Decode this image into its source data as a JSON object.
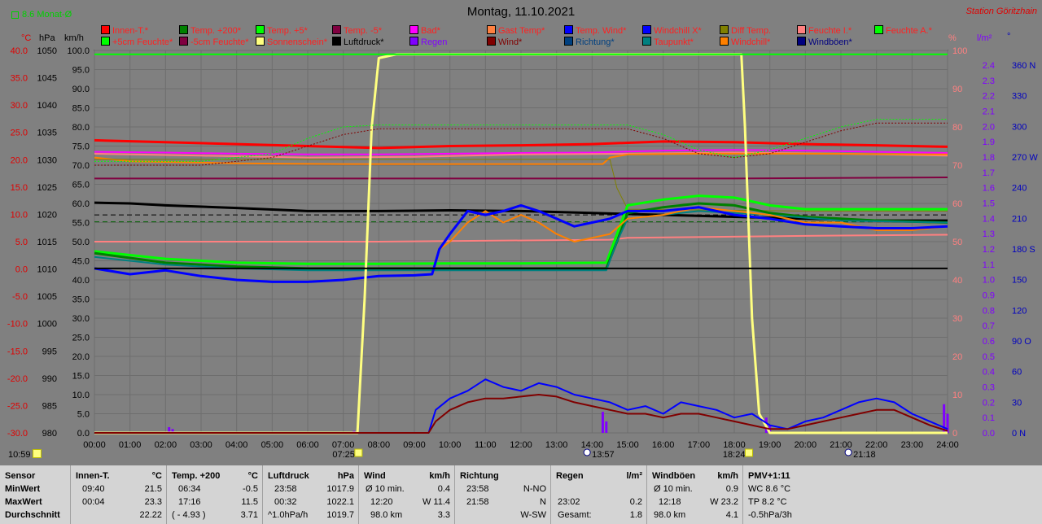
{
  "title": "Montag, 11.10.2021",
  "station": "Station Göritzhain",
  "monat": "8.6 Monat-Ø",
  "axis_headers": {
    "temp": "°C",
    "hpa": "hPa",
    "kmh": "km/h",
    "pct": "%",
    "lqm": "l/m²",
    "deg": "°"
  },
  "legend": [
    {
      "label": "Innen-T.*",
      "color": "#ff0000",
      "text_color": "#ff2020"
    },
    {
      "label": "Temp. +200*",
      "color": "#008000",
      "text_color": "#ff2020"
    },
    {
      "label": "Temp. +5*",
      "color": "#00ff00",
      "text_color": "#ff2020"
    },
    {
      "label": "Temp. -5*",
      "color": "#800040",
      "text_color": "#ff2020"
    },
    {
      "label": "Bad*",
      "color": "#ff00ff",
      "text_color": "#ff2020"
    },
    {
      "label": "Gast Temp*",
      "color": "#ff8040",
      "text_color": "#ff2020"
    },
    {
      "label": "Temp. Wind*",
      "color": "#0000ff",
      "text_color": "#ff2020"
    },
    {
      "label": "Windchill X*",
      "color": "#0000ff",
      "text_color": "#ff2020"
    },
    {
      "label": "Diff Temp.",
      "color": "#808000",
      "text_color": "#ff2020"
    },
    {
      "label": "Feuchte I.*",
      "color": "#ff8080",
      "text_color": "#ff2020"
    },
    {
      "label": "Feuchte A.*",
      "color": "#00ff00",
      "text_color": "#ff2020"
    },
    {
      "label": "+5cm Feuchte*",
      "color": "#00ff00",
      "text_color": "#ff2020"
    },
    {
      "label": "-5cm Feuchte*",
      "color": "#800040",
      "text_color": "#ff2020"
    },
    {
      "label": "Sonnenschein*",
      "color": "#ffff80",
      "text_color": "#ff2020"
    },
    {
      "label": "Luftdruck*",
      "color": "#000000",
      "text_color": "#000000"
    },
    {
      "label": "Regen",
      "color": "#8000ff",
      "text_color": "#8000ff"
    },
    {
      "label": "Wind*",
      "color": "#800000",
      "text_color": "#800000"
    },
    {
      "label": "Richtung*",
      "color": "#004080",
      "text_color": "#004080"
    },
    {
      "label": "Taupunkt*",
      "color": "#008080",
      "text_color": "#ff2020"
    },
    {
      "label": "Windchill*",
      "color": "#ff8000",
      "text_color": "#ff2020"
    },
    {
      "label": "Windböen*",
      "color": "#000080",
      "text_color": "#000080"
    }
  ],
  "chart_data": {
    "type": "line",
    "title": "Montag, 11.10.2021",
    "x_ticks": [
      "00:00",
      "01:00",
      "02:00",
      "03:00",
      "04:00",
      "05:00",
      "06:00",
      "07:00",
      "08:00",
      "09:00",
      "10:00",
      "11:00",
      "12:00",
      "13:00",
      "14:00",
      "15:00",
      "16:00",
      "17:00",
      "18:00",
      "19:00",
      "20:00",
      "21:00",
      "22:00",
      "23:00",
      "24:00"
    ],
    "y_axes": {
      "temp_c": [
        "40.0",
        "35.0",
        "30.0",
        "25.0",
        "20.0",
        "15.0",
        "10.0",
        "5.0",
        "0.0",
        "-5.0",
        "-10.0",
        "-15.0",
        "-20.0",
        "-25.0",
        "-30.0"
      ],
      "hpa": [
        "1050",
        "1045",
        "1040",
        "1035",
        "1030",
        "1025",
        "1020",
        "1015",
        "1010",
        "1005",
        "1000",
        "995",
        "990",
        "985",
        "980"
      ],
      "kmh": [
        "100.0",
        "95.0",
        "90.0",
        "85.0",
        "80.0",
        "75.0",
        "70.0",
        "65.0",
        "60.0",
        "55.0",
        "50.0",
        "45.0",
        "40.0",
        "35.0",
        "30.0",
        "25.0",
        "20.0",
        "15.0",
        "10.0",
        "5.0",
        "0.0"
      ],
      "pct": [
        "100",
        "90",
        "80",
        "70",
        "60",
        "50",
        "40",
        "30",
        "20",
        "10",
        "0"
      ],
      "lqm": [
        "2.4",
        "2.3",
        "2.2",
        "2.1",
        "2.0",
        "1.9",
        "1.8",
        "1.7",
        "1.6",
        "1.5",
        "1.4",
        "1.3",
        "1.2",
        "1.1",
        "1.0",
        "0.9",
        "0.8",
        "0.7",
        "0.6",
        "0.5",
        "0.4",
        "0.3",
        "0.2",
        "0.1",
        "0.0"
      ],
      "deg": [
        "360 N",
        "330",
        "300",
        "270 W",
        "240",
        "210",
        "180 S",
        "150",
        "120",
        "90 O",
        "60",
        "30",
        "0 N"
      ]
    },
    "ylim_kmh": [
      0,
      100
    ],
    "series": [
      {
        "name": "Innen-T.*",
        "color": "#ff0000",
        "width": 3,
        "x": [
          0,
          2,
          4,
          6,
          8,
          10,
          12,
          14,
          16,
          18,
          20,
          22,
          24
        ],
        "y": [
          76.5,
          76.0,
          75.5,
          75.0,
          74.5,
          75.0,
          75.2,
          75.5,
          76.2,
          76.0,
          75.5,
          75.2,
          74.8
        ]
      },
      {
        "name": "Bad*",
        "color": "#ff00ff",
        "width": 2,
        "x": [
          0,
          2,
          4,
          6,
          8,
          10,
          12,
          14,
          16,
          18,
          20,
          22,
          24
        ],
        "y": [
          73.5,
          73.3,
          73.0,
          72.8,
          72.8,
          73.0,
          73.2,
          73.3,
          73.8,
          74.0,
          73.8,
          73.5,
          73.2
        ]
      },
      {
        "name": "Feuchte I.*",
        "color": "#ff8080",
        "width": 2,
        "x": [
          0,
          3,
          6,
          9,
          12,
          15,
          18,
          21,
          24
        ],
        "y": [
          73.0,
          72.5,
          72.0,
          72.2,
          72.8,
          73.0,
          73.3,
          73.0,
          72.5
        ]
      },
      {
        "name": "Gast Temp*",
        "color": "#ff8000",
        "width": 2,
        "x": [
          0,
          1,
          4,
          7,
          9,
          12,
          14.3,
          14.5,
          15,
          17,
          20,
          24
        ],
        "y": [
          72.0,
          71.0,
          70.5,
          70.3,
          70.3,
          70.3,
          70.3,
          72.0,
          72.8,
          73.0,
          73.0,
          72.8
        ]
      },
      {
        "name": "Diff Temp.",
        "color": "#808000",
        "width": 1,
        "x": [
          0,
          3,
          6,
          9,
          12,
          14.5,
          14.7,
          15,
          18,
          20,
          24
        ],
        "y": [
          71.5,
          71.5,
          71.5,
          71.5,
          71.5,
          71.5,
          64,
          58.5,
          58.2,
          58.0,
          58.0
        ]
      },
      {
        "name": "Temp. -5*",
        "color": "#800040",
        "width": 2,
        "x": [
          0,
          6,
          12,
          18,
          24
        ],
        "y": [
          66.5,
          66.5,
          66.5,
          66.5,
          66.8
        ]
      },
      {
        "name": "Luftdruck*",
        "color": "#000000",
        "width": 3,
        "x": [
          0,
          1,
          2,
          4,
          6,
          8,
          10,
          12,
          14,
          16,
          18,
          20,
          22,
          24
        ],
        "y": [
          60.2,
          60.0,
          59.5,
          58.8,
          58.0,
          58.0,
          58.2,
          58.0,
          57.5,
          57.0,
          56.5,
          56.0,
          55.5,
          55.5
        ]
      },
      {
        "name": "Feuchte A. (dashed)",
        "color": "#000000",
        "width": 1,
        "dash": "6,4",
        "x": [
          0,
          24
        ],
        "y": [
          57.0,
          57.0
        ]
      },
      {
        "name": "Feuchte A. (dashed green)",
        "color": "#006000",
        "width": 1,
        "dash": "6,4",
        "x": [
          0,
          24
        ],
        "y": [
          55.2,
          55.2
        ]
      },
      {
        "name": "Feuchte I.* low",
        "color": "#ff8080",
        "width": 2,
        "x": [
          0,
          8,
          14.5,
          15,
          20,
          24
        ],
        "y": [
          50.0,
          50.0,
          50.5,
          51.0,
          51.5,
          51.8
        ]
      },
      {
        "name": "Temp. +5*",
        "color": "#00ff00",
        "width": 3,
        "x": [
          0,
          2,
          4,
          6,
          8,
          10,
          12,
          14.4,
          14.7,
          15,
          16,
          17,
          18,
          19,
          20,
          22,
          24
        ],
        "y": [
          47.5,
          45.5,
          44.5,
          44.2,
          44.2,
          44.3,
          44.3,
          44.5,
          52,
          59.5,
          61,
          62,
          61.5,
          59.5,
          58.5,
          58.5,
          58.5
        ]
      },
      {
        "name": "Temp. +200*",
        "color": "#008000",
        "width": 3,
        "x": [
          0,
          2,
          4,
          6,
          8,
          10,
          12,
          14.4,
          14.7,
          15,
          16,
          17,
          18,
          19,
          20,
          22,
          24
        ],
        "y": [
          47.0,
          44.5,
          43.5,
          43.0,
          43.0,
          43.0,
          43.0,
          43.0,
          50,
          57.5,
          59,
          60,
          59.5,
          57.5,
          56.5,
          55.5,
          55.0
        ]
      },
      {
        "name": "Taupunkt*",
        "color": "#008080",
        "width": 2,
        "x": [
          0,
          2,
          4,
          6,
          8,
          10,
          12,
          14.4,
          14.7,
          15,
          17,
          19,
          21,
          24
        ],
        "y": [
          46.0,
          44.0,
          43.0,
          42.5,
          42.5,
          42.5,
          42.5,
          42.5,
          50,
          56,
          58,
          57,
          55.5,
          55.0
        ]
      },
      {
        "name": "Windchill*",
        "color": "#ff8000",
        "width": 2,
        "x": [
          9.5,
          9.7,
          10,
          10.5,
          11,
          11.5,
          12,
          12.5,
          13,
          13.5,
          14,
          14.5,
          15,
          16,
          17,
          18,
          19,
          20,
          21,
          22,
          23,
          24
        ],
        "y": [
          41.5,
          48,
          50,
          55,
          58,
          55,
          57,
          55,
          52,
          50,
          51,
          52,
          56,
          57,
          59,
          58,
          57,
          55,
          55,
          53,
          53,
          54
        ]
      },
      {
        "name": "Windchill X*",
        "color": "#0000ff",
        "width": 3,
        "x": [
          0,
          1,
          2,
          3,
          4,
          5,
          6,
          7,
          8,
          9,
          9.5,
          9.7,
          10,
          10.5,
          11,
          11.5,
          12,
          12.5,
          13,
          13.5,
          14,
          14.5,
          15,
          16,
          17,
          18,
          19,
          20,
          21,
          22,
          23,
          24
        ],
        "y": [
          43.0,
          41.5,
          42.5,
          41.0,
          40.0,
          39.5,
          39.5,
          40.0,
          41.0,
          41.2,
          41.5,
          48,
          52,
          58,
          57,
          58,
          59.5,
          58,
          56,
          54,
          55,
          56,
          58,
          58,
          59,
          57,
          56,
          54.5,
          54,
          53.5,
          53.5,
          54
        ]
      },
      {
        "name": "Sonnenschein*",
        "color": "#ffff80",
        "width": 3,
        "x": [
          0,
          7.4,
          7.6,
          7.8,
          8.0,
          8.5,
          18.2,
          18.3,
          18.5,
          18.7,
          19,
          24
        ],
        "y": [
          0,
          0,
          35,
          80,
          98,
          99,
          99,
          80,
          30,
          5,
          0,
          0
        ]
      },
      {
        "name": "Feuchte A.*",
        "color": "#00ff00",
        "width": 2,
        "x": [
          0,
          24
        ],
        "y": [
          99,
          99
        ]
      },
      {
        "name": "Luftdruck base",
        "color": "#000000",
        "width": 2,
        "x": [
          0,
          24
        ],
        "y": [
          43,
          43
        ]
      },
      {
        "name": "-5cm Feuchte*",
        "color": "#800000",
        "width": 1,
        "dash": "2,2",
        "x": [
          0,
          3,
          5,
          6,
          7,
          8,
          9,
          12,
          14,
          15,
          16,
          17,
          18,
          19,
          20,
          21,
          22,
          23,
          24
        ],
        "y": [
          70,
          70,
          72,
          75,
          78,
          79.5,
          79.5,
          79.5,
          79.5,
          79.5,
          77,
          73,
          72,
          73,
          76,
          79,
          81,
          81,
          81
        ]
      },
      {
        "name": "+5cm Feuchte*",
        "color": "#00ff00",
        "width": 1,
        "dash": "2,2",
        "x": [
          0,
          3,
          5,
          6,
          7,
          8,
          9,
          12,
          14,
          15,
          16,
          17,
          18,
          19,
          20,
          21,
          22,
          23,
          24
        ],
        "y": [
          71,
          71,
          73,
          77,
          80,
          80.5,
          80.5,
          80.5,
          80.5,
          80.5,
          78,
          74,
          72,
          74,
          77,
          80,
          82,
          82,
          82
        ]
      },
      {
        "name": "Windböen*",
        "color": "#0000ff",
        "width": 2,
        "x": [
          0,
          9.4,
          9.6,
          10,
          10.5,
          11,
          11.5,
          12,
          12.5,
          13,
          13.5,
          14,
          14.5,
          15,
          15.5,
          16,
          16.5,
          17,
          17.5,
          18,
          18.5,
          19,
          19.5,
          20,
          20.5,
          21,
          21.5,
          22,
          22.5,
          23,
          23.5,
          24
        ],
        "y": [
          0,
          0,
          6,
          9,
          11,
          14,
          12,
          11,
          13,
          12,
          10,
          9,
          8,
          6,
          7,
          5,
          8,
          7,
          6,
          4,
          5,
          2,
          1,
          3,
          4,
          6,
          8,
          9,
          8,
          5,
          3,
          1
        ]
      },
      {
        "name": "Wind*",
        "color": "#800000",
        "width": 2,
        "x": [
          0,
          9.4,
          9.6,
          10,
          10.5,
          11,
          11.5,
          12,
          12.5,
          13,
          13.5,
          14,
          14.5,
          15,
          15.5,
          16,
          16.5,
          17,
          17.5,
          18,
          18.5,
          19,
          19.5,
          20,
          20.5,
          21,
          21.5,
          22,
          22.5,
          23,
          23.5,
          24
        ],
        "y": [
          0,
          0,
          3,
          6,
          8,
          9,
          9,
          9.5,
          10,
          9.5,
          8,
          7,
          6,
          5,
          5,
          4,
          5,
          5,
          4,
          3,
          2,
          1,
          1,
          2,
          3,
          4,
          5,
          6,
          6,
          4,
          2,
          0.5
        ]
      }
    ],
    "rain_bars": {
      "x": [
        2.1,
        2.2,
        7.3,
        14.3,
        14.4,
        18.9,
        19.0,
        23.9,
        24.0
      ],
      "y": [
        1.5,
        1.0,
        0.5,
        5.5,
        3.0,
        4.0,
        2.0,
        7.5,
        5.0
      ]
    },
    "sun_markers": [
      {
        "time": "07:25",
        "kind": "sunrise"
      },
      {
        "time": "13:57",
        "kind": "noon"
      },
      {
        "time": "18:24",
        "kind": "sunset"
      },
      {
        "time": "21:18",
        "kind": "moon"
      }
    ],
    "current_time": "10:59"
  },
  "table": {
    "sensor": {
      "header": "Sensor",
      "rows": [
        "MinWert",
        "MaxWert",
        "Durchschnitt"
      ]
    },
    "innen": {
      "header": "Innen-T.",
      "unit": "°C",
      "rows": [
        [
          "09:40",
          "21.5"
        ],
        [
          "00:04",
          "23.3"
        ],
        [
          "",
          "22.22"
        ]
      ]
    },
    "temp200": {
      "header": "Temp. +200",
      "unit": "°C",
      "rows": [
        [
          "06:34",
          "-0.5"
        ],
        [
          "17:16",
          "11.5"
        ],
        [
          "( - 4.93 )",
          "3.71"
        ]
      ]
    },
    "luftdruck": {
      "header": "Luftdruck",
      "unit": "hPa",
      "rows": [
        [
          "23:58",
          "1017.9"
        ],
        [
          "00:32",
          "1022.1"
        ],
        [
          "^1.0hPa/h",
          "1019.7"
        ]
      ]
    },
    "wind": {
      "header": "Wind",
      "unit": "km/h",
      "rows": [
        [
          "Ø 10 min.",
          "0.4"
        ],
        [
          "12:20",
          "W 11.4"
        ],
        [
          "98.0 km",
          "3.3"
        ]
      ]
    },
    "richtung": {
      "header": "Richtung",
      "unit": "",
      "rows": [
        [
          "23:58",
          "N-NO"
        ],
        [
          "21:58",
          "N"
        ],
        [
          "",
          "W-SW"
        ]
      ]
    },
    "regen": {
      "header": "Regen",
      "unit": "l/m²",
      "rows": [
        [
          "",
          ""
        ],
        [
          "23:02",
          "0.2"
        ],
        [
          "Gesamt:",
          "1.8"
        ]
      ]
    },
    "windboeen": {
      "header": "Windböen",
      "unit": "km/h",
      "rows": [
        [
          "Ø 10 min.",
          "0.9"
        ],
        [
          "12:18",
          "W 23.2"
        ],
        [
          "98.0 km",
          "4.1"
        ]
      ]
    },
    "pmv": {
      "header": "PMV+1:11",
      "rows": [
        "WC 8.6 °C",
        "TP 8.2 °C",
        "-0.5hPa/3h"
      ]
    }
  }
}
